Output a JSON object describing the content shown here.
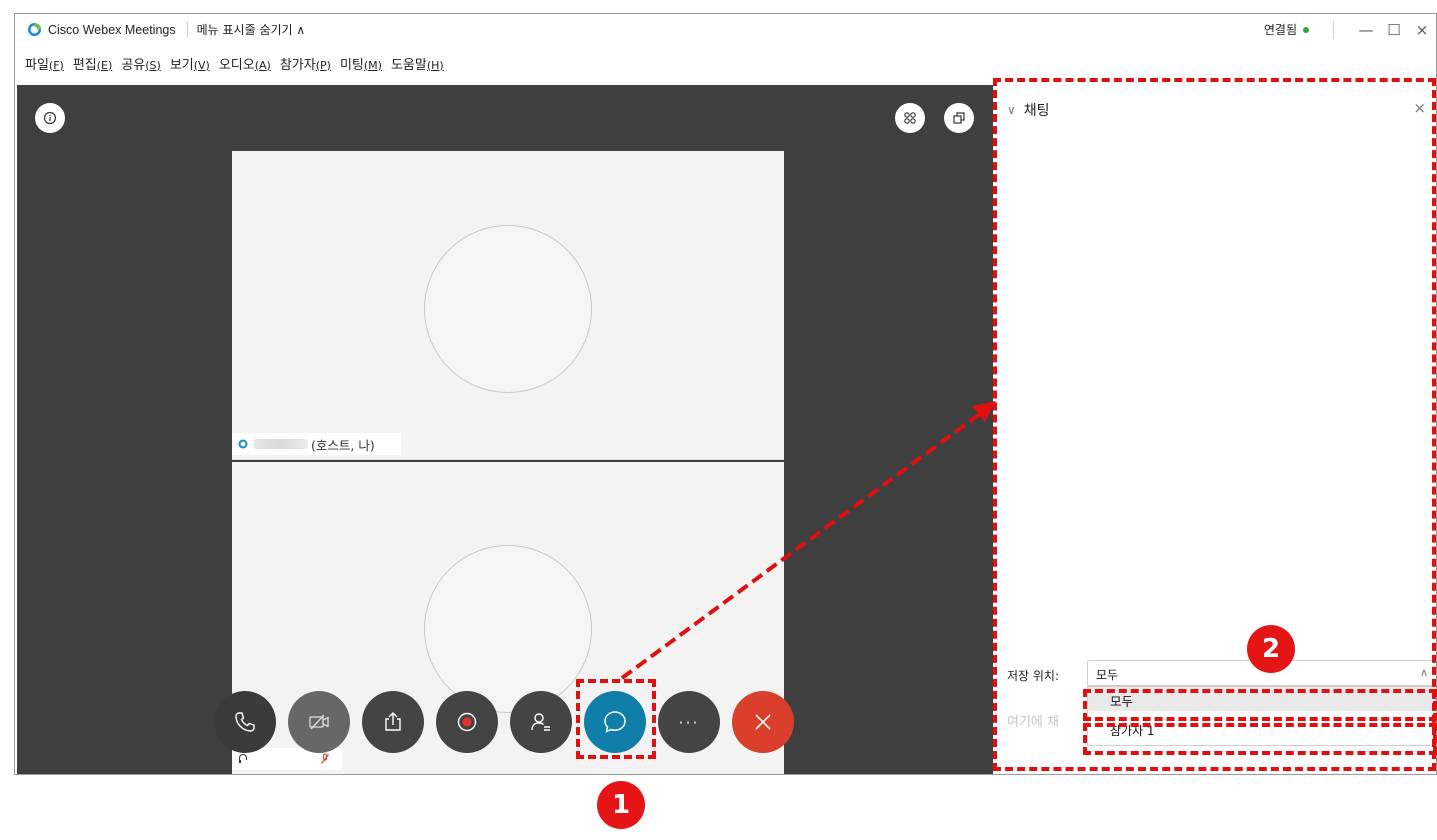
{
  "titlebar": {
    "app_name": "Cisco Webex Meetings",
    "menu_toggle": "메뉴 표시줄 숨기기 ∧",
    "status": "연결됨",
    "status_color": "#2fa33f",
    "minimize": "—",
    "maximize": "☐",
    "close": "×"
  },
  "menubar": {
    "items": [
      {
        "label": "파일",
        "key": "(F)"
      },
      {
        "label": "편집",
        "key": "(E)"
      },
      {
        "label": "공유",
        "key": "(S)"
      },
      {
        "label": "보기",
        "key": "(V)"
      },
      {
        "label": "오디오",
        "key": "(A)"
      },
      {
        "label": "참가자",
        "key": "(P)"
      },
      {
        "label": "미팅",
        "key": "(M)"
      },
      {
        "label": "도움말",
        "key": "(H)"
      }
    ]
  },
  "video": {
    "host_suffix": "(호스트, 나)"
  },
  "controls": [
    {
      "name": "audio",
      "icon": "phone-icon"
    },
    {
      "name": "video",
      "icon": "video-off-icon"
    },
    {
      "name": "share",
      "icon": "share-icon"
    },
    {
      "name": "record",
      "icon": "record-icon"
    },
    {
      "name": "participants",
      "icon": "participants-icon"
    },
    {
      "name": "chat",
      "icon": "chat-icon"
    },
    {
      "name": "more",
      "icon": "more-icon",
      "text": "···"
    },
    {
      "name": "end",
      "icon": "close-icon"
    }
  ],
  "chat": {
    "title": "채팅",
    "to_label": "저장 위치:",
    "to_value": "모두",
    "input_placeholder": "여기에 채",
    "options": [
      "모두",
      "참가자 1"
    ]
  },
  "annotations": {
    "badge_1": "1",
    "badge_2": "2",
    "color": "#e01010"
  },
  "colors": {
    "stage_bg": "#3f3f3f",
    "chat_button": "#0f7ea8",
    "end_button": "#d93f2b"
  }
}
